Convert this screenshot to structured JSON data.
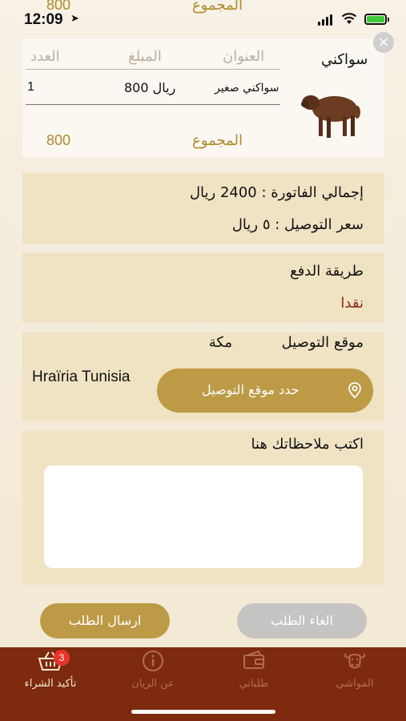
{
  "status_bar": {
    "time": "12:09"
  },
  "header_peek": {
    "amount": "800",
    "label": "المجموع"
  },
  "item": {
    "category": "سواكني",
    "columns": {
      "title": "العنوان",
      "amount": "المبلغ",
      "count": "العدد"
    },
    "row": {
      "title": "سواكني صغير",
      "amount": "800 ريال",
      "count": "1"
    },
    "total_label": "المجموع",
    "total_value": "800"
  },
  "invoice": {
    "total_label": "إجمالي الفاتورة : 2400 ريال",
    "delivery_label": "سعر التوصيل : ٥ ريال"
  },
  "payment": {
    "title": "طريقة الدفع",
    "method": "نقدا",
    "method_color": "#8a2a12"
  },
  "delivery": {
    "title": "موقع التوصيل",
    "city": "مكة",
    "address": "Hraïria Tunisia",
    "select_button": "حدد موقع التوصيل"
  },
  "notes": {
    "title": "اكتب ملاحظاتك هنا",
    "value": ""
  },
  "actions": {
    "cancel": "الغاء الطلب",
    "send": "ارسال الطلب"
  },
  "tabs": [
    {
      "label": "المواشي",
      "icon": "cow-icon"
    },
    {
      "label": "طلباتي",
      "icon": "wallet-icon"
    },
    {
      "label": "عن الريان",
      "icon": "info-icon"
    },
    {
      "label": "تأكيد الشراء",
      "icon": "basket-icon",
      "badge": "3",
      "active": true
    }
  ],
  "colors": {
    "accent": "#bd9a46",
    "tabbar": "#7e2a0e",
    "panel": "#efe3c4"
  }
}
